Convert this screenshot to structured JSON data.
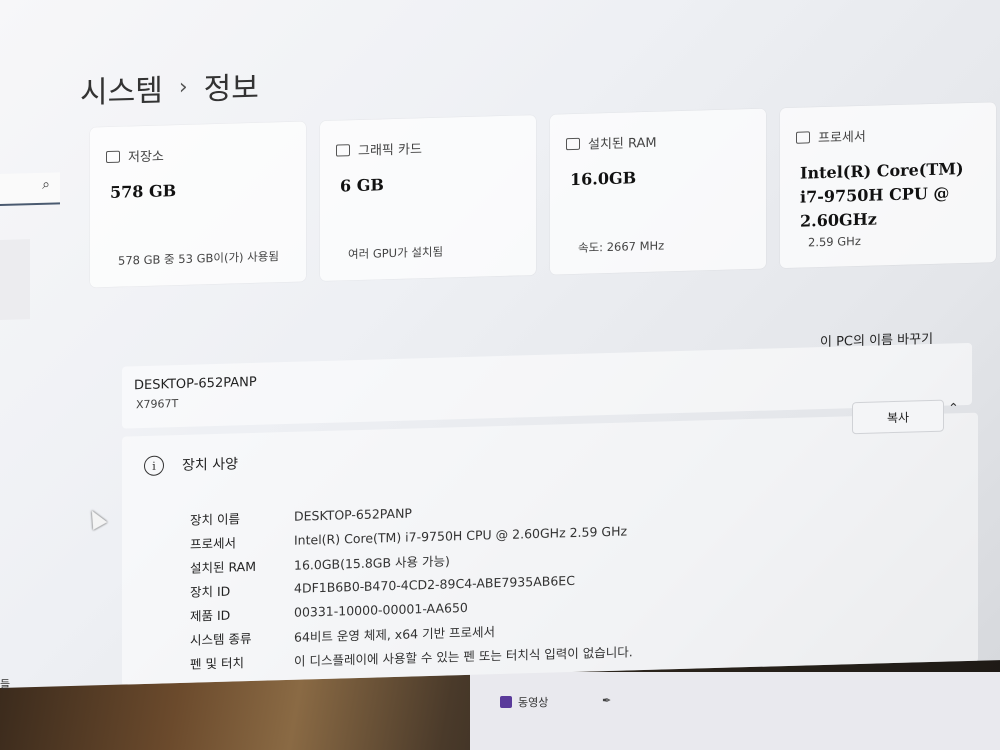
{
  "breadcrumb": {
    "parent": "시스템",
    "separator": "›",
    "current": "정보"
  },
  "search": {
    "icon": "search-icon"
  },
  "cards": [
    {
      "icon": "storage-icon",
      "label": "저장소",
      "value": "578 GB",
      "sub": "578 GB 중 53 GB이(가) 사용됨"
    },
    {
      "icon": "graphics-card-icon",
      "label": "그래픽 카드",
      "value": "6 GB",
      "sub": "여러 GPU가 설치됨"
    },
    {
      "icon": "ram-icon",
      "label": "설치된 RAM",
      "value": "16.0GB",
      "sub": "속도: 2667 MHz"
    },
    {
      "icon": "processor-icon",
      "label": "프로세서",
      "value": "Intel(R) Core(TM) i7-9750H CPU @ 2.60GHz",
      "sub": "2.59 GHz"
    }
  ],
  "device": {
    "name": "DESKTOP-652PANP",
    "model": "X7967T",
    "rename_label": "이 PC의 이름 바꾸기"
  },
  "specs": {
    "title": "장치 사양",
    "copy_label": "복사",
    "rows": [
      {
        "key": "장치 이름",
        "value": "DESKTOP-652PANP"
      },
      {
        "key": "프로세서",
        "value": "Intel(R) Core(TM) i7-9750H CPU @ 2.60GHz   2.59 GHz"
      },
      {
        "key": "설치된 RAM",
        "value": "16.0GB(15.8GB 사용 가능)"
      },
      {
        "key": "장치 ID",
        "value": "4DF1B6B0-B470-4CD2-89C4-ABE7935AB6EC"
      },
      {
        "key": "제품 ID",
        "value": "00331-10000-00001-AA650"
      },
      {
        "key": "시스템 종류",
        "value": "64비트 운영 체제, x64 기반 프로세서"
      },
      {
        "key": "펜 및 터치",
        "value": "이 디스플레이에 사용할 수 있는 펜 또는 터치식 입력이 없습니다."
      }
    ]
  },
  "taskbar": {
    "item_label": "동영상",
    "left_stub": "들"
  }
}
